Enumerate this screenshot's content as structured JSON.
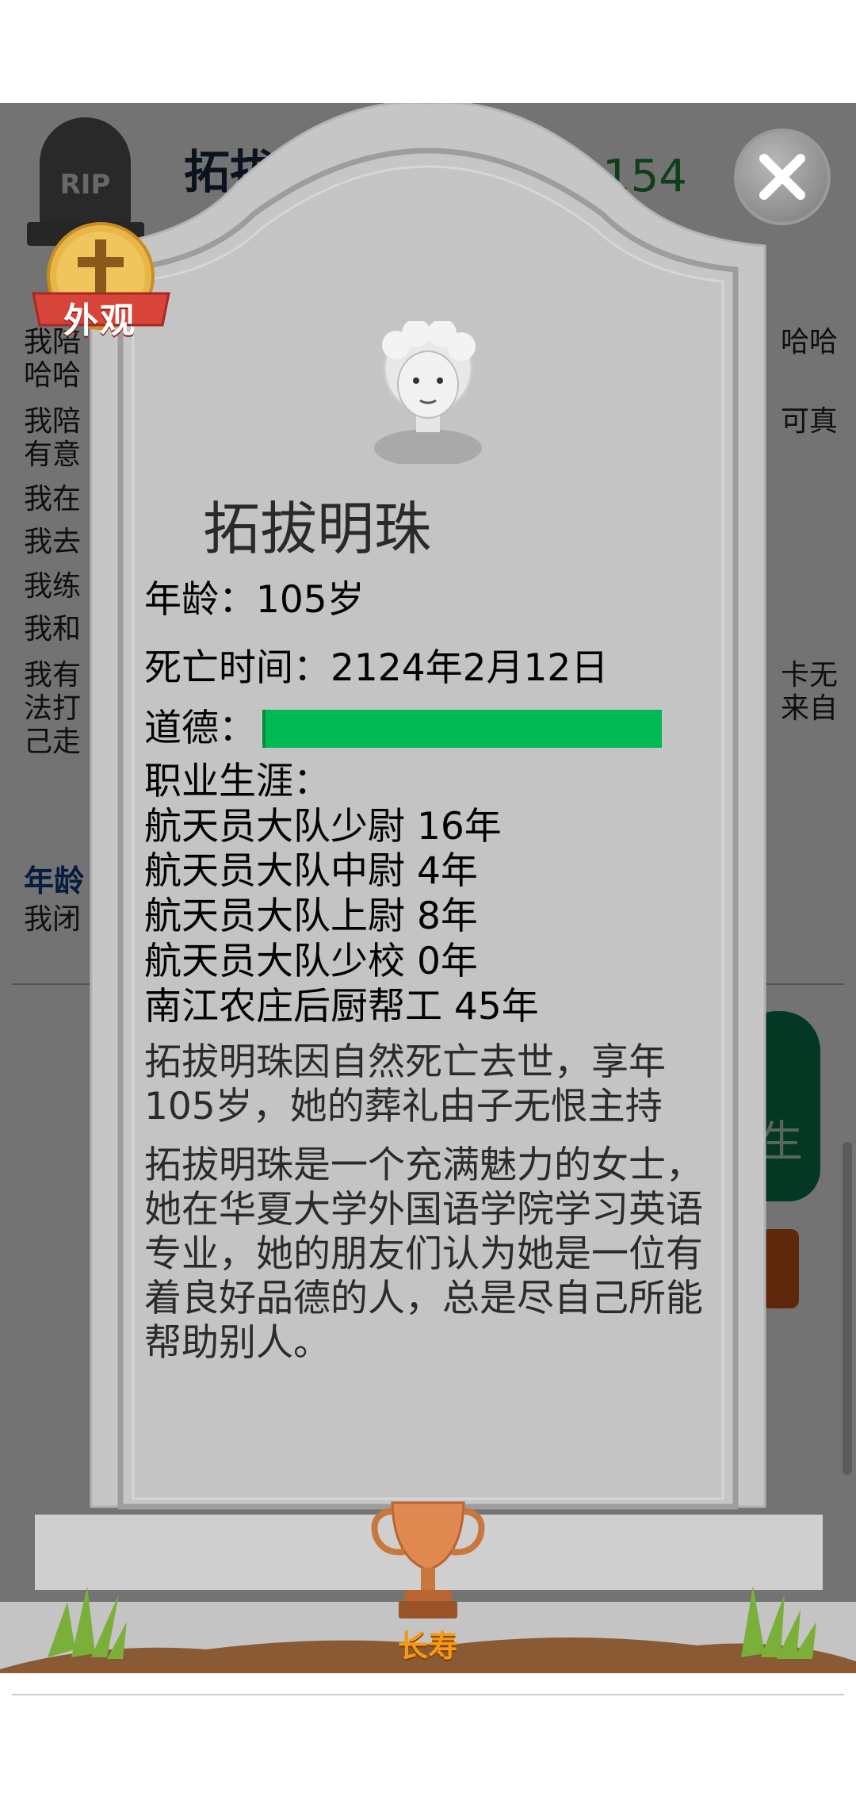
{
  "background": {
    "name_partial": "拓拔",
    "count_partial": "154",
    "logs": [
      "我陪",
      "哈哈",
      "我陪",
      "有意",
      "我在",
      "我去",
      "我练",
      "我和",
      "我有",
      "法打",
      "己走"
    ],
    "logs_right": [
      "哈哈",
      "可真",
      "卡无",
      "来自"
    ],
    "age_label": "年龄",
    "age_text": "我闭",
    "green_button_char": "生"
  },
  "badge": {
    "appearance_label": "外观"
  },
  "tombstone": {
    "name": "拓拔明珠",
    "age_line": "年龄：105岁",
    "death_time_line": "死亡时间：2124年2月12日",
    "morality_label": "道德：",
    "morality_value": 1.0,
    "career_header": "职业生涯：",
    "careers": [
      "航天员大队少尉 16年",
      "航天员大队中尉 4年",
      "航天员大队上尉 8年",
      "航天员大队少校 0年",
      "南江农庄后厨帮工 45年"
    ],
    "death_paragraph": "拓拔明珠因自然死亡去世，享年105岁，她的葬礼由子无恨主持",
    "bio_paragraph": "拓拔明珠是一个充满魅力的女士，她在华夏大学外国语学院学习英语专业，她的朋友们认为她是一位有着良好品德的人，总是尽自己所能帮助别人。"
  },
  "trophy": {
    "label": "长寿"
  },
  "colors": {
    "morality": "#00b955",
    "stone": "#c6c6c6",
    "trophy": "#e08a52"
  },
  "icons": [
    "rip-tombstone-icon",
    "cross-icon",
    "close-icon",
    "trophy-icon",
    "elder-avatar-icon",
    "grass-icon"
  ]
}
